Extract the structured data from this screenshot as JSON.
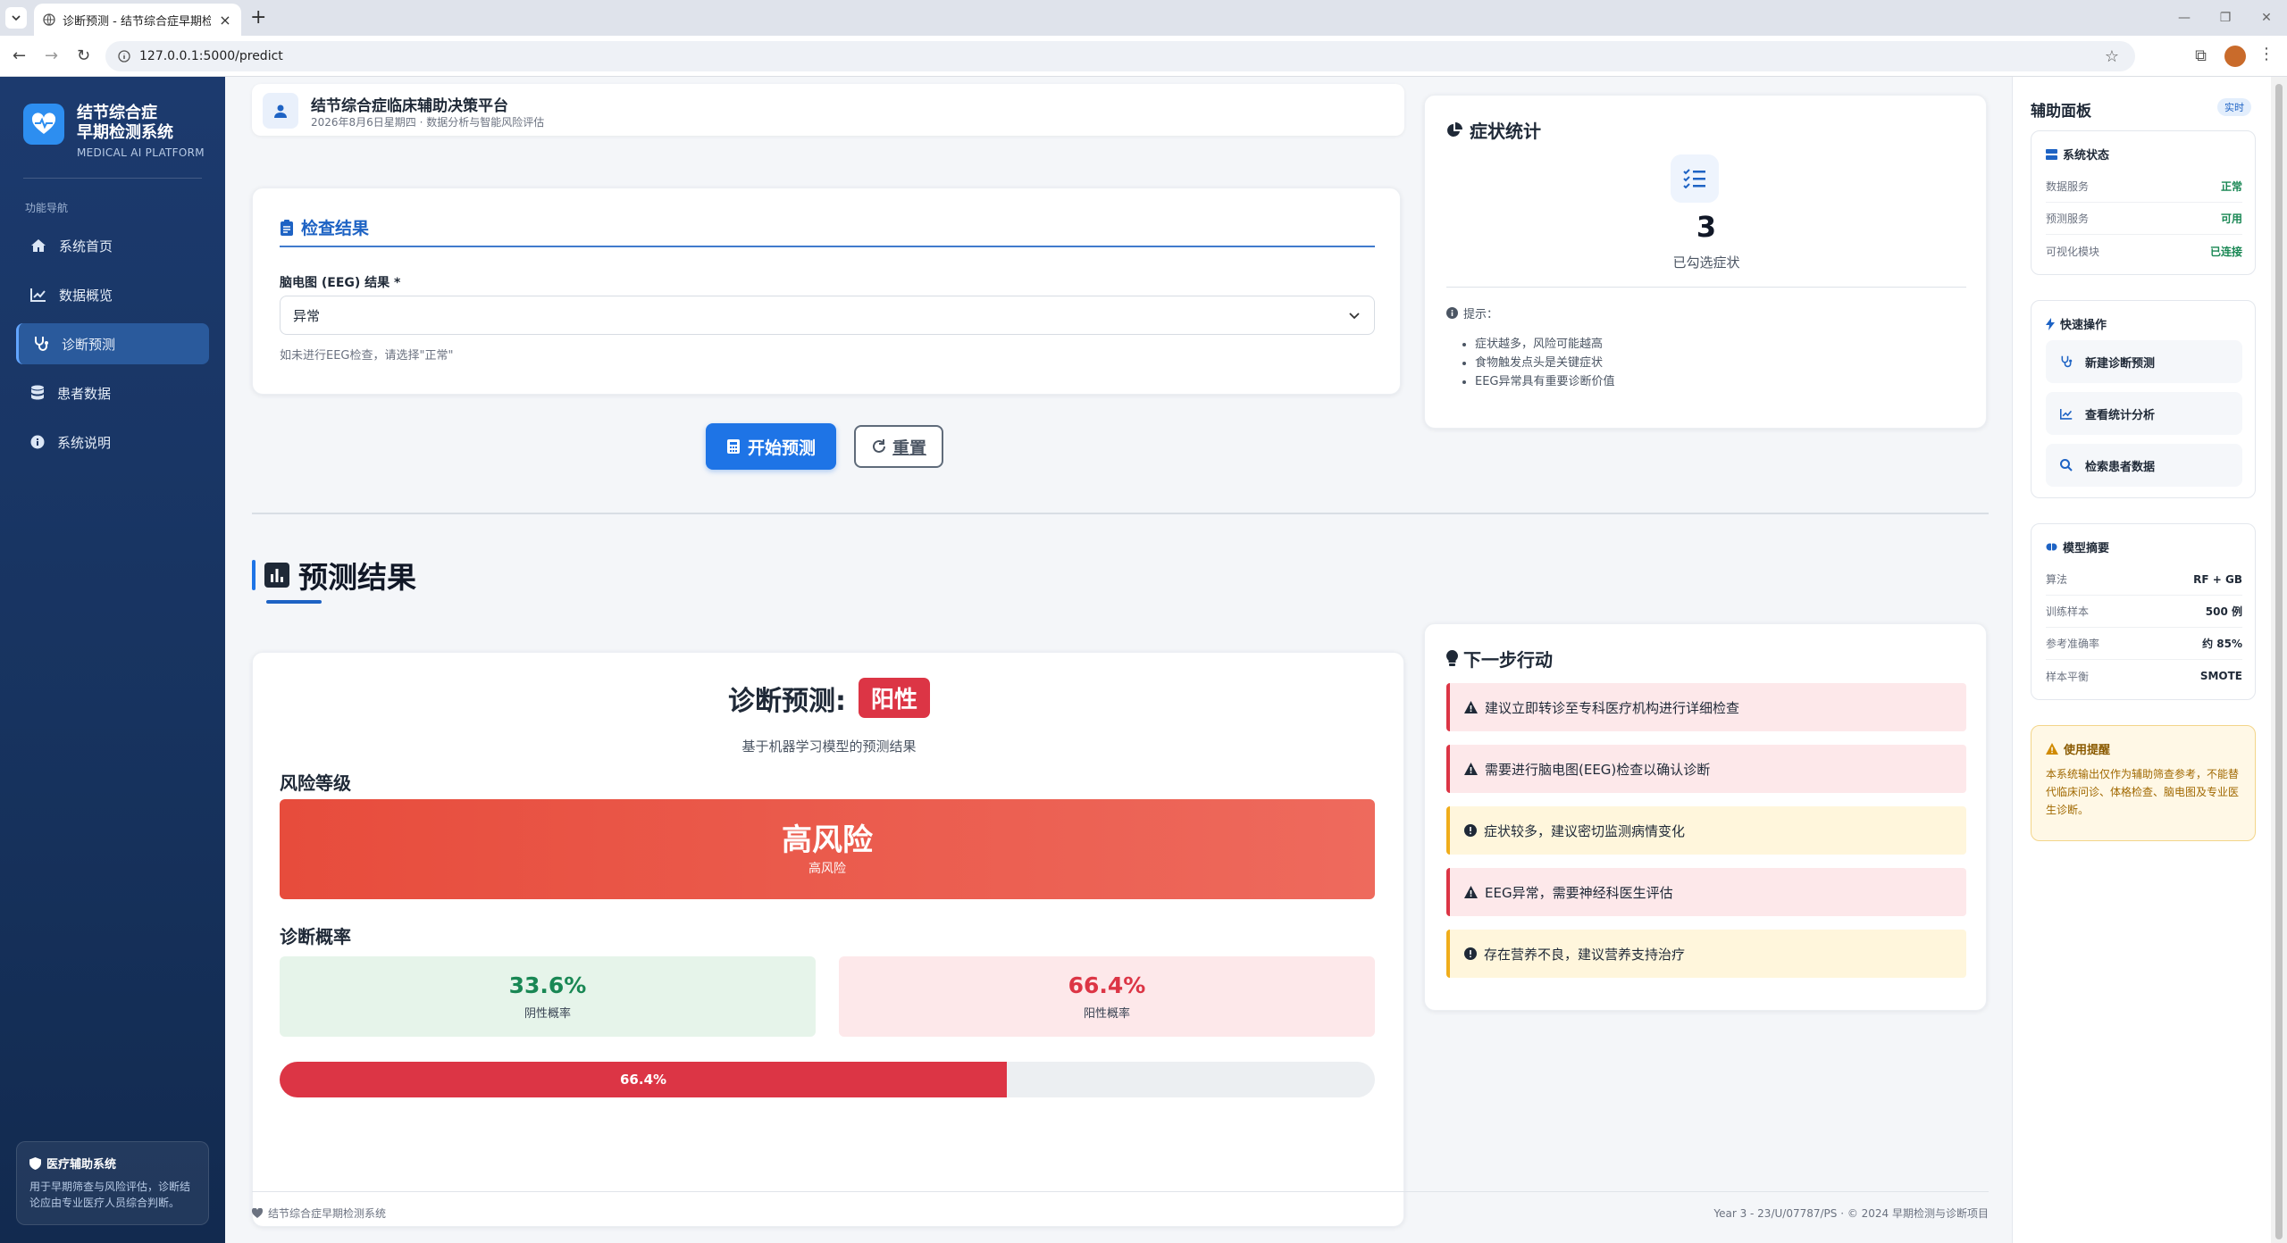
{
  "browser": {
    "tab_title": "诊断预测 - 结节综合症早期检测",
    "url": "127.0.0.1:5000/predict"
  },
  "sidebar": {
    "brand_line1": "结节综合症",
    "brand_line2": "早期检测系统",
    "brand_sub": "MEDICAL AI PLATFORM",
    "nav_label": "功能导航",
    "items": [
      {
        "label": "系统首页",
        "icon": "home-icon"
      },
      {
        "label": "数据概览",
        "icon": "chart-line-icon"
      },
      {
        "label": "诊断预测",
        "icon": "stethoscope-icon"
      },
      {
        "label": "患者数据",
        "icon": "database-icon"
      },
      {
        "label": "系统说明",
        "icon": "info-icon"
      }
    ],
    "active_index": 2,
    "card_title": "医疗辅助系统",
    "card_text": "用于早期筛查与风险评估，诊断结论应由专业医疗人员综合判断。"
  },
  "topbar": {
    "title": "结节综合症临床辅助决策平台",
    "subtitle": "2026年8月6日星期四 · 数据分析与智能风险评估"
  },
  "exam": {
    "title": "检查结果",
    "eeg_label": "脑电图 (EEG) 结果 *",
    "eeg_value": "异常",
    "eeg_hint": "如未进行EEG检查，请选择\"正常\""
  },
  "buttons": {
    "predict": "开始预测",
    "reset": "重置"
  },
  "result": {
    "section_title": "预测结果",
    "diag_label": "诊断预测:",
    "diag_value": "阳性",
    "diag_sub": "基于机器学习模型的预测结果",
    "risk_label": "风险等级",
    "risk_main": "高风险",
    "risk_sub": "高风险",
    "prob_label": "诊断概率",
    "neg_value": "33.6%",
    "neg_caption": "阴性概率",
    "pos_value": "66.4%",
    "pos_caption": "阳性概率",
    "bar_percent": 66.4,
    "bar_text": "66.4%"
  },
  "stats": {
    "title": "症状统计",
    "count": "3",
    "count_caption": "已勾选症状",
    "tip_head": "提示：",
    "tips": [
      "症状越多，风险可能越高",
      "食物触发点头是关键症状",
      "EEG异常具有重要诊断价值"
    ]
  },
  "next": {
    "title": "下一步行动",
    "actions": [
      {
        "text": "建议立即转诊至专科医疗机构进行详细检查",
        "level": "danger"
      },
      {
        "text": "需要进行脑电图(EEG)检查以确认诊断",
        "level": "danger"
      },
      {
        "text": "症状较多，建议密切监测病情变化",
        "level": "warn"
      },
      {
        "text": "EEG异常，需要神经科医生评估",
        "level": "danger"
      },
      {
        "text": "存在营养不良，建议营养支持治疗",
        "level": "warn"
      }
    ]
  },
  "footer": {
    "left": "结节综合症早期检测系统",
    "right": "Year 3 - 23/U/07787/PS · © 2024 早期检测与诊断项目"
  },
  "rpanel": {
    "title": "辅助面板",
    "badge": "实时",
    "status_title": "系统状态",
    "status": [
      {
        "k": "数据服务",
        "v": "正常"
      },
      {
        "k": "预测服务",
        "v": "可用"
      },
      {
        "k": "可视化模块",
        "v": "已连接"
      }
    ],
    "quick_title": "快速操作",
    "quick": [
      {
        "label": "新建诊断预测",
        "icon": "stethoscope-icon"
      },
      {
        "label": "查看统计分析",
        "icon": "chart-line-icon"
      },
      {
        "label": "检索患者数据",
        "icon": "search-icon"
      }
    ],
    "model_title": "模型摘要",
    "model": [
      {
        "k": "算法",
        "v": "RF + GB"
      },
      {
        "k": "训练样本",
        "v": "500 例"
      },
      {
        "k": "参考准确率",
        "v": "约 85%"
      },
      {
        "k": "样本平衡",
        "v": "SMOTE"
      }
    ],
    "warn_title": "使用提醒",
    "warn_text": "本系统输出仅作为辅助筛查参考，不能替代临床问诊、体格检查、脑电图及专业医生诊断。"
  },
  "colors": {
    "primary": "#1e74e6",
    "danger": "#dc3545",
    "success": "#198754",
    "warning": "#f0ad1b",
    "sidebar": "#17335f"
  }
}
